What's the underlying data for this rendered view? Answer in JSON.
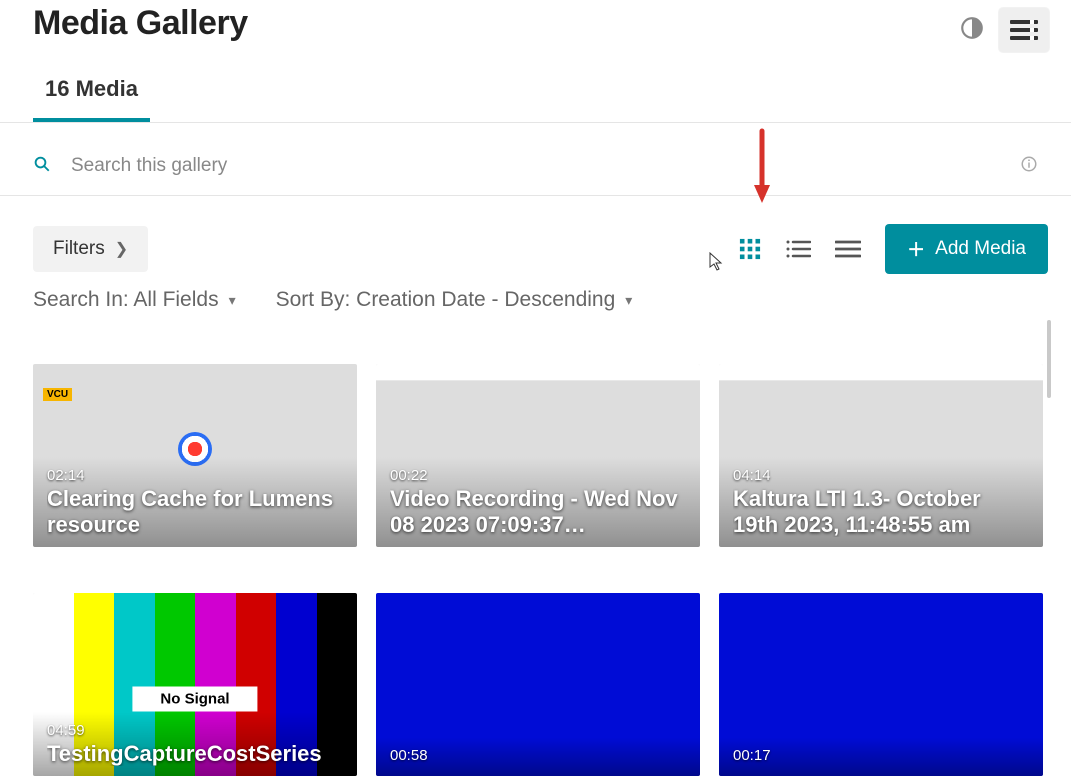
{
  "header": {
    "title": "Media Gallery"
  },
  "tabs": {
    "media_count_label": "16 Media"
  },
  "search": {
    "placeholder": "Search this gallery"
  },
  "controls": {
    "filters_label": "Filters",
    "add_media_label": "Add Media"
  },
  "sort": {
    "search_in_label": "Search In: All Fields",
    "sort_by_label": "Sort By: Creation Date - Descending"
  },
  "gallery": {
    "items": [
      {
        "duration": "02:14",
        "title": "Clearing Cache for Lumens resource"
      },
      {
        "duration": "00:22",
        "title": "Video Recording - Wed Nov 08 2023 07:09:37…"
      },
      {
        "duration": "04:14",
        "title": "Kaltura LTI 1.3- October 19th 2023, 11:48:55 am"
      },
      {
        "duration": "04:59",
        "title": "TestingCaptureCostSeries",
        "nosignal": "No Signal"
      },
      {
        "duration": "00:58",
        "title": ""
      },
      {
        "duration": "00:17",
        "title": ""
      }
    ]
  }
}
